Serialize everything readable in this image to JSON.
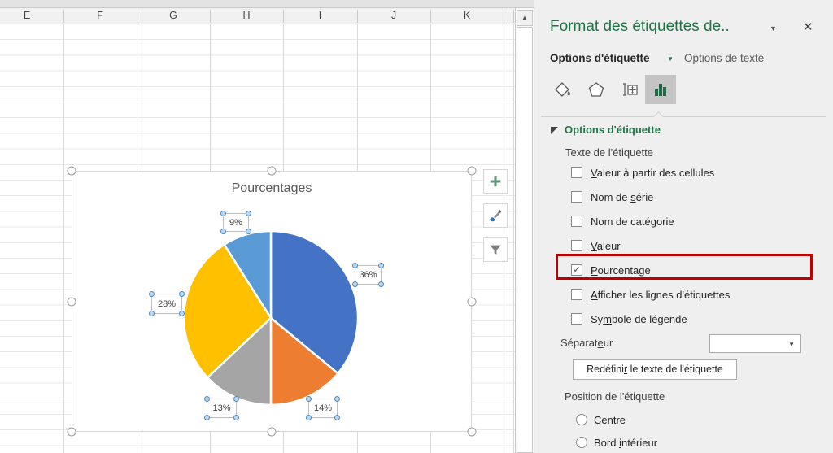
{
  "icons": {
    "scroll_up": "▲",
    "panel_caret": "▼",
    "tab_caret": "▼",
    "combo_caret": "▼",
    "close": "✕",
    "checkmark": "✓"
  },
  "spreadsheet": {
    "columns": [
      "E",
      "F",
      "G",
      "H",
      "I",
      "J",
      "K"
    ]
  },
  "chart_data": {
    "type": "pie",
    "title": "Pourcentages",
    "slices": [
      {
        "label": "36%",
        "value": 36,
        "color": "#4472C4"
      },
      {
        "label": "14%",
        "value": 14,
        "color": "#ED7D31"
      },
      {
        "label": "13%",
        "value": 13,
        "color": "#A5A5A5"
      },
      {
        "label": "28%",
        "value": 28,
        "color": "#FFC000"
      },
      {
        "label": "9%",
        "value": 9,
        "color": "#5B9BD5"
      }
    ],
    "start_angle_deg": 0,
    "direction": "clockwise",
    "legend": "none",
    "data_labels": "percentage, outside end"
  },
  "panel": {
    "title": "Format des étiquettes de..",
    "tabs": [
      {
        "label": "Options d'étiquette",
        "active": true
      },
      {
        "label": "Options de texte",
        "active": false
      }
    ],
    "section_title": "Options d'étiquette",
    "group_label": "Texte de l'étiquette",
    "checkboxes": [
      {
        "label": "Valeur à partir des cellules",
        "accel": 0,
        "checked": false,
        "highlighted": false
      },
      {
        "label": "Nom de série",
        "accel": 7,
        "checked": false,
        "highlighted": false
      },
      {
        "label": "Nom de catégorie",
        "accel": 11,
        "checked": false,
        "highlighted": false
      },
      {
        "label": "Valeur",
        "accel": 0,
        "checked": false,
        "highlighted": false
      },
      {
        "label": "Pourcentage",
        "accel": 0,
        "checked": true,
        "highlighted": true
      },
      {
        "label": "Afficher les lignes d'étiquettes",
        "accel": 0,
        "checked": false,
        "highlighted": false
      },
      {
        "label": "Symbole de légende",
        "accel": 2,
        "checked": false,
        "highlighted": false
      }
    ],
    "separator_label": "Séparateur",
    "separator_accel": 7,
    "separator_value": "",
    "reset_button": {
      "label": "Redéfinir le texte de l'étiquette",
      "accel": 8
    },
    "position_label": "Position de l'étiquette",
    "radios": [
      {
        "label": "Centre",
        "accel": 0,
        "selected": false
      },
      {
        "label": "Bord intérieur",
        "accel": 5,
        "selected": false
      }
    ]
  },
  "colors": {
    "excel_green": "#217346",
    "highlight_red": "#C00000",
    "panel_bg": "#F0EFEF",
    "selected_icon_bg": "#C4C4C4"
  }
}
